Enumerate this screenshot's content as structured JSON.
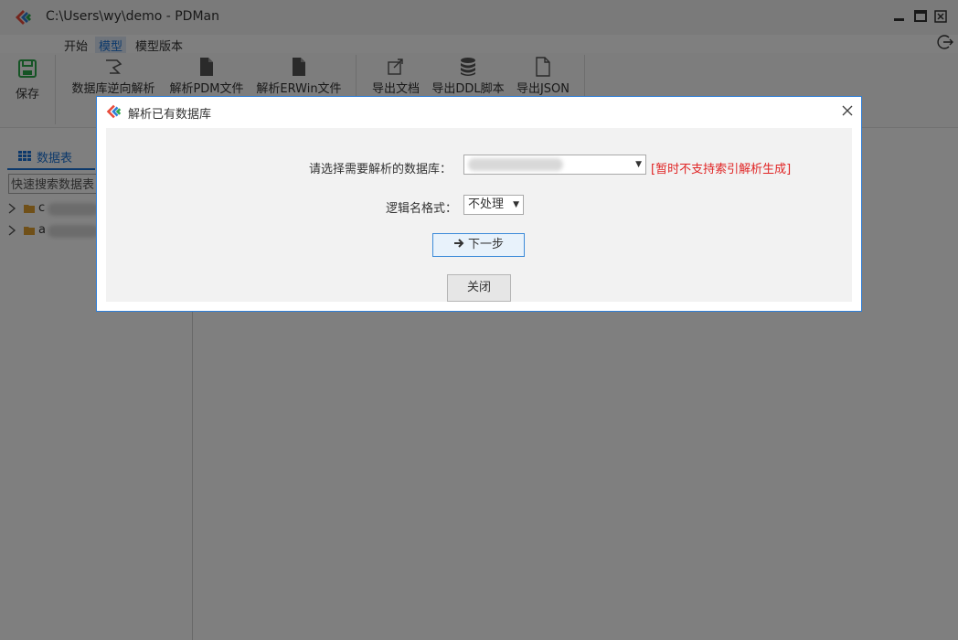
{
  "window": {
    "title": "C:\\Users\\wy\\demo - PDMan"
  },
  "menu": {
    "items": [
      {
        "label": "开始",
        "active": false
      },
      {
        "label": "模型",
        "active": true
      },
      {
        "label": "模型版本",
        "active": false
      }
    ]
  },
  "ribbon": {
    "save": "保存",
    "tools": [
      {
        "label": "数据库逆向解析",
        "icon": "reverse-parse-icon"
      },
      {
        "label": "解析PDM文件",
        "icon": "file-icon"
      },
      {
        "label": "解析ERWin文件",
        "icon": "file-icon"
      },
      {
        "label": "导出文档",
        "icon": "export-icon"
      },
      {
        "label": "导出DDL脚本",
        "icon": "database-icon"
      },
      {
        "label": "导出JSON",
        "icon": "file-outline-icon"
      }
    ]
  },
  "sidebar": {
    "tab": "数据表",
    "search_value": "快速搜索数据表",
    "tree": [
      {
        "label": "c"
      },
      {
        "label": "a"
      }
    ]
  },
  "dialog": {
    "title": "解析已有数据库",
    "db_label": "请选择需要解析的数据库：",
    "db_value": "",
    "warning": "[暂时不支持索引解析生成]",
    "logic_label": "逻辑名格式：",
    "logic_value": "不处理",
    "next_button": "下一步",
    "close_button": "关闭"
  },
  "colors": {
    "accent": "#1a73d6",
    "warning": "#e02424",
    "dialog_border": "#2f7fd8"
  }
}
